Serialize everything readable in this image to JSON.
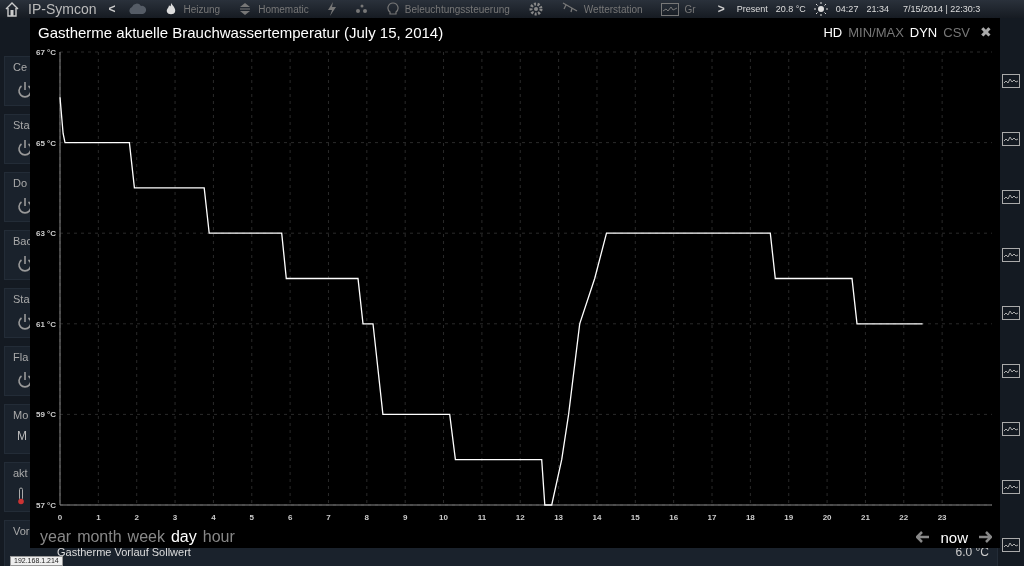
{
  "top_bar": {
    "brand": "IP-Symcon",
    "back": "<",
    "forward": ">",
    "nav": [
      {
        "kind": "cloud"
      },
      {
        "kind": "flame",
        "label": "Heizung"
      },
      {
        "kind": "stairs",
        "label": "Homematic"
      },
      {
        "kind": "bolt"
      },
      {
        "kind": "drops"
      },
      {
        "kind": "bulb",
        "label": "Beleuchtungssteuerung"
      },
      {
        "kind": "gear"
      },
      {
        "kind": "antenna",
        "label": "Wetterstation"
      },
      {
        "kind": "graph",
        "label": "Gr"
      }
    ],
    "presence": "Present",
    "temperature": "20.8 °C",
    "sunrise": "04:27",
    "sunset": "21:34",
    "datetime": "7/15/2014 | 22:30:3"
  },
  "cards": [
    {
      "label": "Ce",
      "kind": "power"
    },
    {
      "label": "Sta",
      "kind": "power"
    },
    {
      "label": "Do",
      "kind": "power"
    },
    {
      "label": "Bac",
      "kind": "power"
    },
    {
      "label": "Sta",
      "kind": "power"
    },
    {
      "label": "Fla",
      "kind": "power"
    },
    {
      "label": "Mo",
      "kind": "text",
      "value": "M"
    },
    {
      "label": "akt",
      "kind": "thermo"
    },
    {
      "label": "Vor",
      "kind": "plain",
      "name": "Gastherme Vorlauf Sollwert",
      "reading": "6.0 °C"
    }
  ],
  "dialog": {
    "title": "Gastherme aktuelle Brauchwassertemperatur (July 15, 2014)",
    "options": [
      {
        "label": "HD",
        "selected": true
      },
      {
        "label": "MIN/MAX",
        "selected": false
      },
      {
        "label": "DYN",
        "selected": true
      },
      {
        "label": "CSV",
        "selected": false
      }
    ],
    "close": "✖",
    "chart_data": {
      "type": "line",
      "x": [
        0,
        0.08,
        0.13,
        1.81,
        1.94,
        3.76,
        3.89,
        5.78,
        5.9,
        7.77,
        7.9,
        8.16,
        8.42,
        10.16,
        10.31,
        12.56,
        12.64,
        12.82,
        13.08,
        13.26,
        13.55,
        13.94,
        14.25,
        18.52,
        18.65,
        20.65,
        20.78,
        22.49
      ],
      "grid": true,
      "series": [
        {
          "color": "#ffffff",
          "values": [
            66.0,
            65.2,
            65.0,
            65.0,
            64.0,
            64.0,
            63.0,
            63.0,
            62.0,
            62.0,
            61.0,
            61.0,
            59.0,
            59.0,
            58.0,
            58.0,
            57.0,
            57.0,
            58.0,
            59.0,
            61.0,
            62.0,
            63.0,
            63.0,
            62.0,
            62.0,
            61.0,
            61.0
          ]
        }
      ],
      "xlim": [
        0,
        24.3
      ],
      "ylim": [
        57,
        67
      ],
      "xticks": [
        0,
        1,
        2,
        3,
        4,
        5,
        6,
        7,
        8,
        9,
        10,
        11,
        12,
        13,
        14,
        15,
        16,
        17,
        18,
        19,
        20,
        21,
        22,
        23
      ],
      "yticks": [
        {
          "value": 57,
          "label": "57 °C"
        },
        {
          "value": 59,
          "label": "59 °C"
        },
        {
          "value": 61,
          "label": "61 °C"
        },
        {
          "value": 63,
          "label": "63 °C"
        },
        {
          "value": 65,
          "label": "65 °C"
        },
        {
          "value": 67,
          "label": "67 °C"
        }
      ]
    },
    "periods": [
      {
        "label": "year",
        "selected": false
      },
      {
        "label": "month",
        "selected": false
      },
      {
        "label": "week",
        "selected": false
      },
      {
        "label": "day",
        "selected": true
      },
      {
        "label": "hour",
        "selected": false
      }
    ],
    "now": "now"
  },
  "status_tooltip": "192.168.1.214"
}
